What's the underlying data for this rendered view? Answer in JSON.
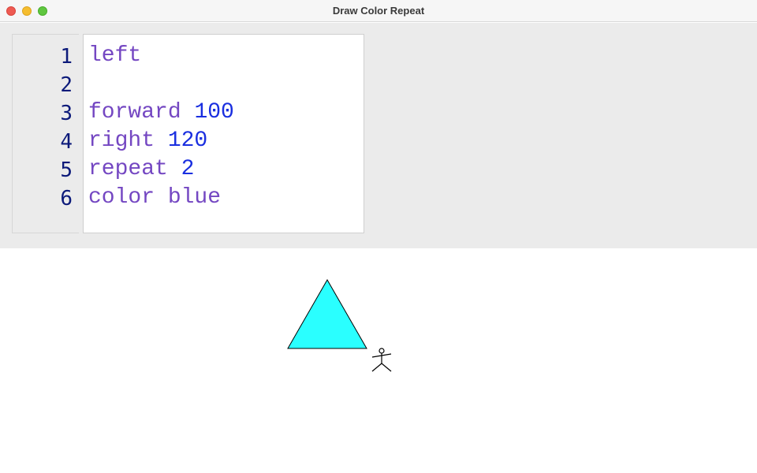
{
  "window": {
    "title": "Draw Color Repeat"
  },
  "editor": {
    "line_numbers": [
      "1",
      "2",
      "3",
      "4",
      "5",
      "6"
    ],
    "lines": [
      {
        "keyword": "left",
        "space": "",
        "value": ""
      },
      {
        "keyword": "",
        "space": "",
        "value": ""
      },
      {
        "keyword": "forward",
        "space": " ",
        "value": "100"
      },
      {
        "keyword": "right",
        "space": " ",
        "value": "120"
      },
      {
        "keyword": "repeat",
        "space": " ",
        "value": "2"
      },
      {
        "keyword": "color blue",
        "space": "",
        "value": ""
      }
    ]
  },
  "canvas": {
    "triangle": {
      "fill": "#2affff",
      "stroke": "#000000"
    },
    "turtle": {
      "icon": "stick-figure-icon",
      "stroke": "#000000"
    }
  }
}
